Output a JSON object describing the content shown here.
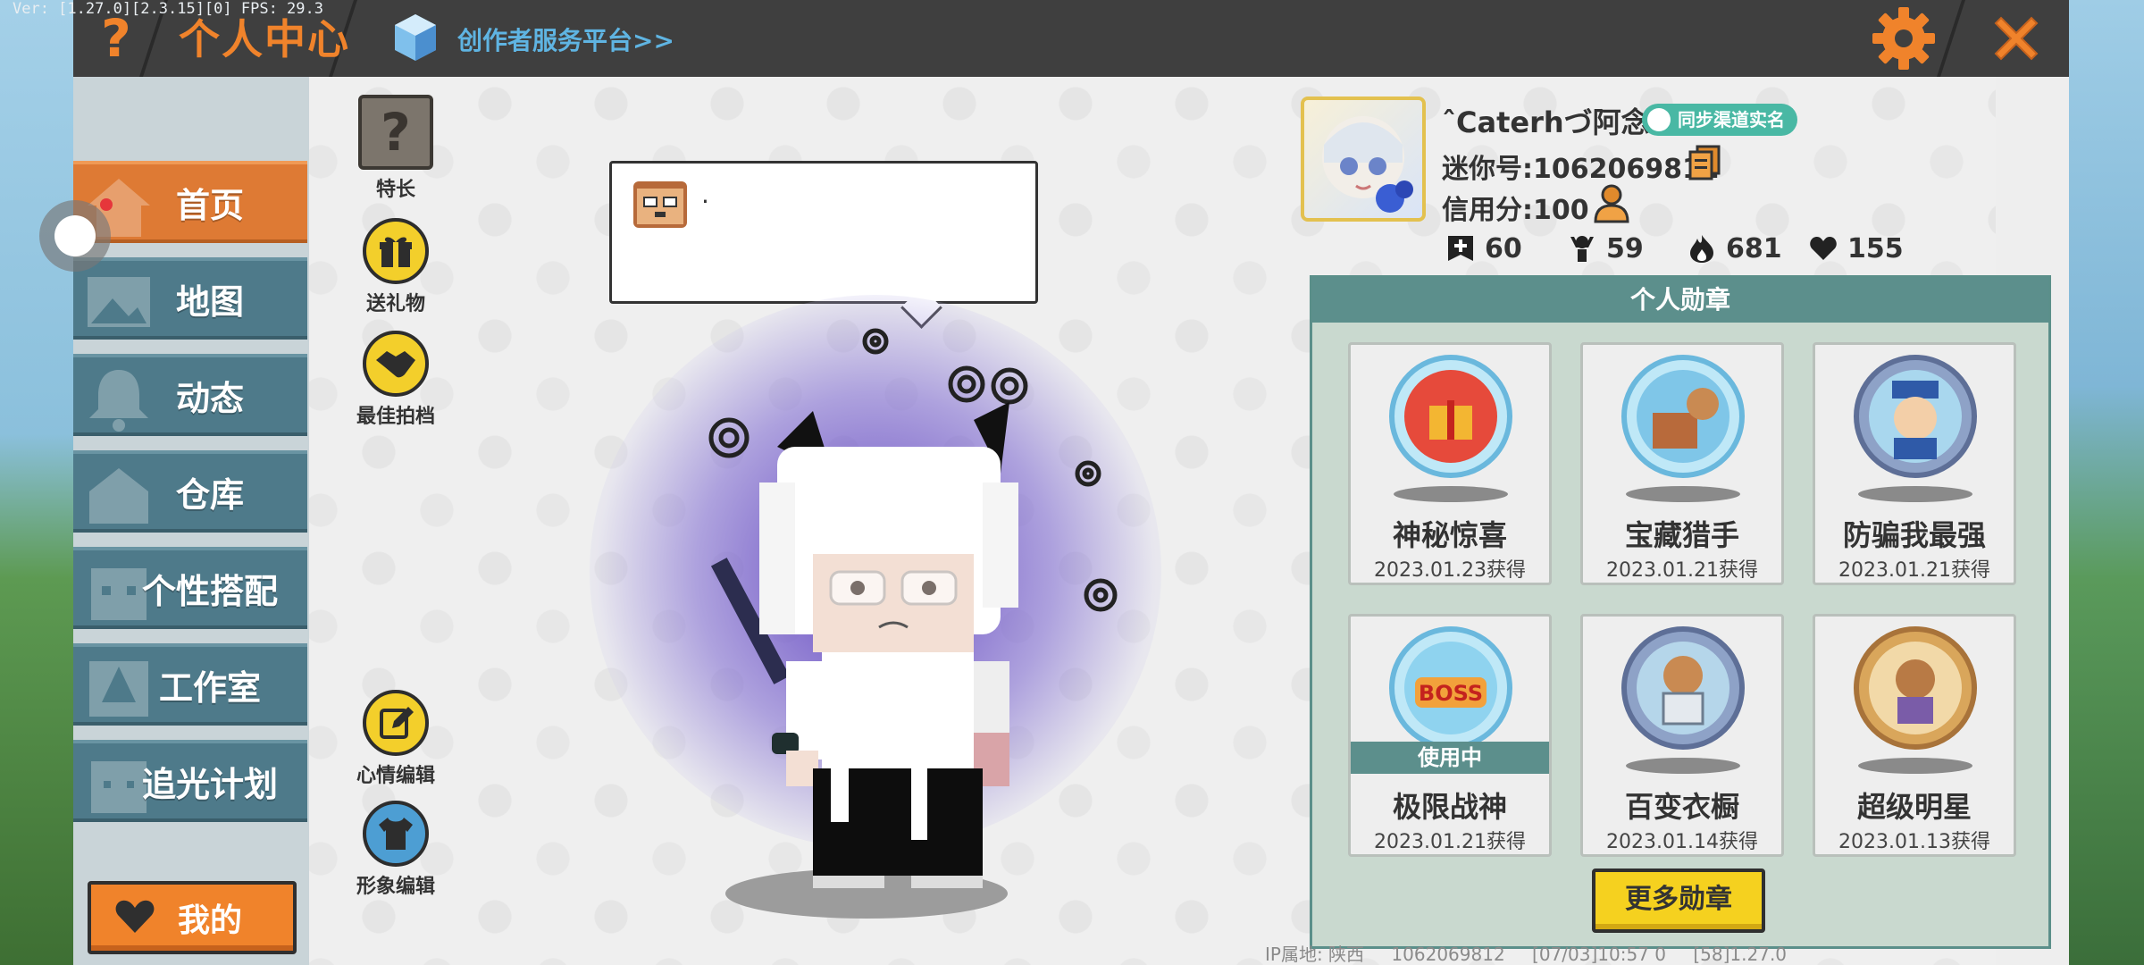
{
  "debug": "Ver: [1.27.0][2.3.15][0] FPS: 29.3",
  "header": {
    "title": "个人中心",
    "creator_link": "创作者服务平台>>"
  },
  "sidebar": {
    "items": [
      {
        "label": "首页",
        "active": true
      },
      {
        "label": "地图"
      },
      {
        "label": "动态"
      },
      {
        "label": "仓库"
      },
      {
        "label": "个性搭配"
      },
      {
        "label": "工作室"
      },
      {
        "label": "追光计划"
      }
    ],
    "mine_label": "我的"
  },
  "tools": {
    "specialty": "特长",
    "gift": "送礼物",
    "best_photo": "最佳拍档",
    "mood_edit": "心情编辑",
    "image_edit": "形象编辑"
  },
  "bubble": {
    "text": "."
  },
  "profile": {
    "nickname": "ˆCaterhづ阿念",
    "verify_label": "同步渠道实名",
    "mini_id": "迷你号:1062069812",
    "credit": "信用分:100",
    "stats": {
      "likes": "60",
      "fans": "59",
      "heat": "681",
      "favor": "155"
    }
  },
  "medals": {
    "title": "个人勋章",
    "items": [
      {
        "name": "神秘惊喜",
        "date": "2023.01.23获得"
      },
      {
        "name": "宝藏猎手",
        "date": "2023.01.21获得"
      },
      {
        "name": "防骗我最强",
        "date": "2023.01.21获得"
      },
      {
        "name": "极限战神",
        "date": "2023.01.21获得",
        "status": "使用中"
      },
      {
        "name": "百变衣橱",
        "date": "2023.01.14获得"
      },
      {
        "name": "超级明星",
        "date": "2023.01.13获得"
      }
    ],
    "more_label": "更多勋章"
  },
  "footer": {
    "ip": "IP属地: 陕西",
    "id": "1062069812",
    "time": "[07/03]10:57 0",
    "version": "[58]1.27.0"
  },
  "colors": {
    "accent_orange": "#f0832b",
    "nav_teal": "#4e7a8a",
    "medal_teal": "#5c8f8c",
    "link_blue": "#5fb4e2"
  }
}
